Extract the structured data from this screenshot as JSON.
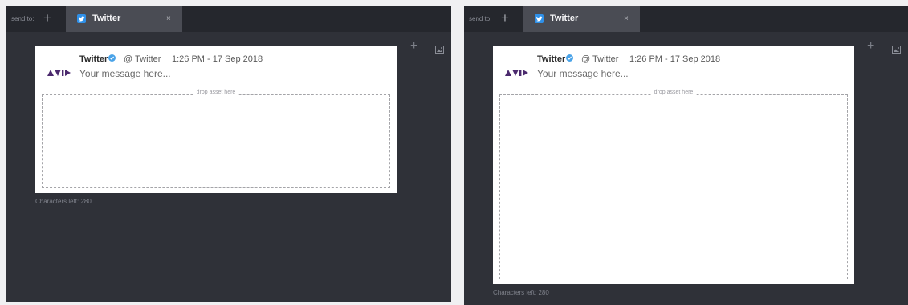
{
  "panels": [
    {
      "send_to_label": "send to:",
      "add_icon": "plus-icon",
      "tab": {
        "icon": "twitter-icon",
        "label": "Twitter",
        "close": "×"
      },
      "tools": {
        "add_icon": "plus-icon",
        "image_icon": "image-icon"
      },
      "tweet": {
        "logo": "avid-logo",
        "author": "Twitter",
        "handle": "@ Twitter",
        "timestamp": "1:26 PM - 17 Sep 2018",
        "message": "Your message here...",
        "drop_placeholder": "drop asset here"
      },
      "characters_left": "Characters left: 280"
    },
    {
      "send_to_label": "send to:",
      "add_icon": "plus-icon",
      "tab": {
        "icon": "twitter-icon",
        "label": "Twitter",
        "close": "×"
      },
      "tools": {
        "add_icon": "plus-icon",
        "image_icon": "image-icon"
      },
      "tweet": {
        "logo": "avid-logo",
        "author": "Twitter",
        "handle": "@ Twitter",
        "timestamp": "1:26 PM - 17 Sep 2018",
        "message": "Your message here...",
        "drop_placeholder": "drop asset here"
      },
      "characters_left": "Characters left: 280"
    }
  ],
  "colors": {
    "panel_bg": "#2f3138",
    "tabbar_bg": "#25272d",
    "active_tab_bg": "#4a4c54",
    "twitter_blue": "#2f90e8",
    "card_bg": "#ffffff",
    "logo": "#4b2a6e"
  }
}
